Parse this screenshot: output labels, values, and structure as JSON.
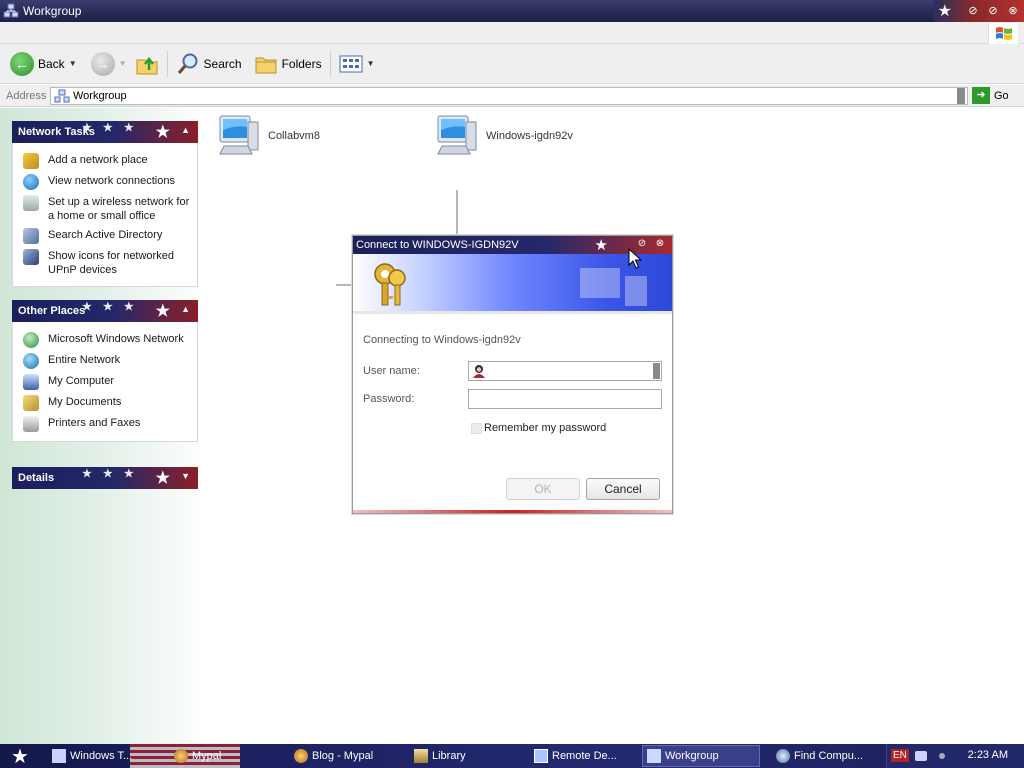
{
  "window": {
    "title": "Workgroup"
  },
  "toolbar": {
    "back_label": "Back",
    "search_label": "Search",
    "folders_label": "Folders"
  },
  "address": {
    "label": "Address",
    "value": "Workgroup",
    "go_label": "Go"
  },
  "panels": {
    "network_tasks": {
      "title": "Network Tasks",
      "items": [
        {
          "label": "Add a network place",
          "icon": "add-network-place-icon"
        },
        {
          "label": "View network connections",
          "icon": "network-connections-icon"
        },
        {
          "label": "Set up a wireless network for a home or small office",
          "icon": "wireless-icon"
        },
        {
          "label": "Search Active Directory",
          "icon": "search-directory-icon"
        },
        {
          "label": "Show icons for networked UPnP devices",
          "icon": "upnp-icon"
        }
      ]
    },
    "other_places": {
      "title": "Other Places",
      "items": [
        {
          "label": "Microsoft Windows Network",
          "icon": "windows-network-icon"
        },
        {
          "label": "Entire Network",
          "icon": "globe-icon"
        },
        {
          "label": "My Computer",
          "icon": "my-computer-icon"
        },
        {
          "label": "My Documents",
          "icon": "my-documents-icon"
        },
        {
          "label": "Printers and Faxes",
          "icon": "printer-icon"
        }
      ]
    },
    "details": {
      "title": "Details"
    }
  },
  "computers": [
    {
      "name": "Collabvm8"
    },
    {
      "name": "Windows-igdn92v"
    }
  ],
  "dialog": {
    "title": "Connect to WINDOWS-IGDN92V",
    "connecting_text": "Connecting to Windows-igdn92v",
    "username_label": "User name:",
    "username_value": "",
    "password_label": "Password:",
    "password_value": "",
    "remember_label": "Remember my password",
    "remember_checked": false,
    "ok_label": "OK",
    "cancel_label": "Cancel"
  },
  "taskbar": {
    "items": [
      {
        "label": "Windows T...",
        "icon": "window-icon",
        "active": false
      },
      {
        "label": "Mypal",
        "icon": "browser-icon",
        "active": false
      },
      {
        "label": "Blog - Mypal",
        "icon": "browser-icon",
        "active": false
      },
      {
        "label": "Library",
        "icon": "library-icon",
        "active": false
      },
      {
        "label": "Remote De...",
        "icon": "remote-desktop-icon",
        "active": false
      },
      {
        "label": "Workgroup",
        "icon": "network-icon",
        "active": true
      },
      {
        "label": "Find Compu...",
        "icon": "search-icon",
        "active": false
      }
    ],
    "language": "EN",
    "clock": "2:23 AM"
  },
  "colors": {
    "title_bar": "#262a55",
    "accent_red": "#b53030",
    "left_pane": "#cfe6d6",
    "go_green": "#2f9a2c"
  }
}
